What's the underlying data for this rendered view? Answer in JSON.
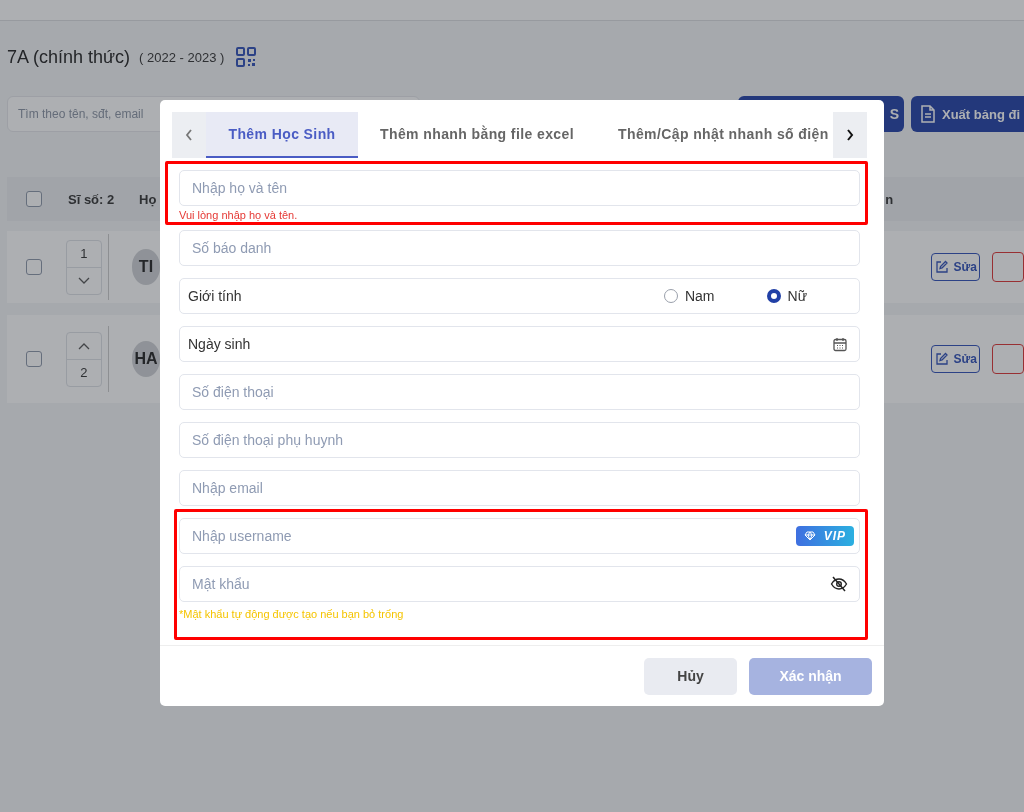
{
  "page": {
    "class_title": "7A (chính thức)",
    "school_year": "( 2022 - 2023 )",
    "search": {
      "placeholder": "Tìm theo tên, sđt, email"
    },
    "buttons": [
      {
        "label": "S",
        "kind": "plain"
      },
      {
        "label": "Xuất bảng đi",
        "kind": "export"
      }
    ],
    "table": {
      "header": {
        "checked": false,
        "count": "Sĩ số: 2",
        "column_2": "Họ",
        "column_3": "n"
      },
      "rows": [
        {
          "checked": false,
          "order": "1",
          "can_move_up": false,
          "can_move_down": true,
          "avatar": "TI",
          "edit": "Sửa"
        },
        {
          "checked": false,
          "order": "2",
          "can_move_up": true,
          "can_move_down": false,
          "avatar": "HA",
          "edit": "Sửa"
        }
      ]
    }
  },
  "modal": {
    "tabs": [
      {
        "label": "Thêm Học Sinh",
        "selected": true
      },
      {
        "label": "Thêm nhanh bằng file excel",
        "selected": false
      },
      {
        "label": "Thêm/Cập nhật nhanh số điện",
        "selected": false
      }
    ],
    "field_groups": [
      {
        "highlighted": true,
        "fields": [
          {
            "kind": "text",
            "placeholder": "Nhập họ và tên",
            "error": "Vui lòng nhập họ và tên."
          }
        ]
      },
      {
        "fields": [
          {
            "kind": "text",
            "placeholder": "Số báo danh"
          },
          {
            "kind": "gender",
            "label": "Giới tính",
            "options": [
              {
                "label": "Nam",
                "selected": false
              },
              {
                "label": "Nữ",
                "selected": true
              }
            ]
          },
          {
            "kind": "date",
            "label": "Ngày sinh"
          },
          {
            "kind": "text",
            "placeholder": "Số điện thoại"
          },
          {
            "kind": "text",
            "placeholder": "Số điện thoại phụ huynh"
          },
          {
            "kind": "text",
            "placeholder": "Nhập email"
          }
        ]
      },
      {
        "highlighted": true,
        "fields": [
          {
            "kind": "username",
            "placeholder": "Nhập username",
            "badge": "VIP"
          },
          {
            "kind": "password",
            "placeholder": "Mật khẩu",
            "hint": "*Mật khẩu tự động được tạo nếu bạn bỏ trống"
          }
        ]
      }
    ],
    "buttons": [
      {
        "label": "Hủy",
        "kind": "secondary",
        "disabled": false
      },
      {
        "label": "Xác nhận",
        "kind": "primary",
        "disabled": true
      }
    ]
  }
}
